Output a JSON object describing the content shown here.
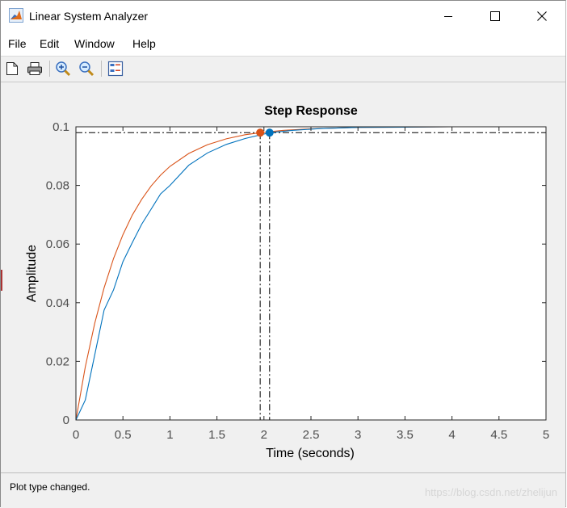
{
  "window": {
    "title": "Linear System Analyzer",
    "controls": [
      "minimize",
      "maximize",
      "close"
    ]
  },
  "menu": {
    "items": [
      "File",
      "Edit",
      "Window",
      "Help"
    ]
  },
  "toolbar": {
    "tools": [
      "new-figure-icon",
      "print-icon",
      "zoom-in-icon",
      "zoom-out-icon",
      "plot-configurations-icon"
    ]
  },
  "status": {
    "message": "Plot type changed.",
    "watermark": "https://blog.csdn.net/zhelijun"
  },
  "chart_data": {
    "type": "line",
    "title": "Step Response",
    "xlabel": "Time (seconds)",
    "ylabel": "Amplitude",
    "xlim": [
      0,
      5
    ],
    "ylim": [
      0,
      0.1
    ],
    "xticks": [
      "0",
      "0.5",
      "1",
      "1.5",
      "2",
      "2.5",
      "3",
      "3.5",
      "4",
      "4.5",
      "5"
    ],
    "yticks": [
      "0",
      "0.02",
      "0.04",
      "0.06",
      "0.08",
      "0.1"
    ],
    "grid": false,
    "steady_state": 0.1,
    "settling_band": 0.098,
    "series": [
      {
        "color": "#d95319",
        "x": [
          0,
          0.1,
          0.2,
          0.3,
          0.4,
          0.5,
          0.6,
          0.7,
          0.8,
          0.9,
          1.0,
          1.2,
          1.4,
          1.6,
          1.8,
          1.96,
          2.2,
          2.5,
          3.0,
          3.5,
          4.0,
          4.5,
          5.0
        ],
        "y": [
          0,
          0.0181,
          0.033,
          0.0451,
          0.0551,
          0.0632,
          0.0699,
          0.0753,
          0.0798,
          0.0835,
          0.0865,
          0.0909,
          0.0939,
          0.0959,
          0.0973,
          0.098,
          0.0988,
          0.0993,
          0.0998,
          0.0999,
          0.1,
          0.1,
          0.1
        ],
        "settling_point": {
          "x": 1.96,
          "y": 0.098
        }
      },
      {
        "color": "#0072bd",
        "x": [
          0,
          0.1,
          0.2,
          0.3,
          0.4,
          0.5,
          0.6,
          0.7,
          0.8,
          0.9,
          1.0,
          1.2,
          1.4,
          1.6,
          1.8,
          2.06,
          2.3,
          2.6,
          3.0,
          3.5,
          4.0,
          4.5,
          5.0
        ],
        "y": [
          0,
          0.0068,
          0.0222,
          0.0375,
          0.0444,
          0.054,
          0.0605,
          0.0668,
          0.0719,
          0.0771,
          0.08,
          0.0869,
          0.0911,
          0.094,
          0.096,
          0.098,
          0.0988,
          0.0994,
          0.0998,
          0.0999,
          0.1,
          0.1,
          0.1
        ],
        "settling_point": {
          "x": 2.06,
          "y": 0.098
        }
      }
    ]
  }
}
